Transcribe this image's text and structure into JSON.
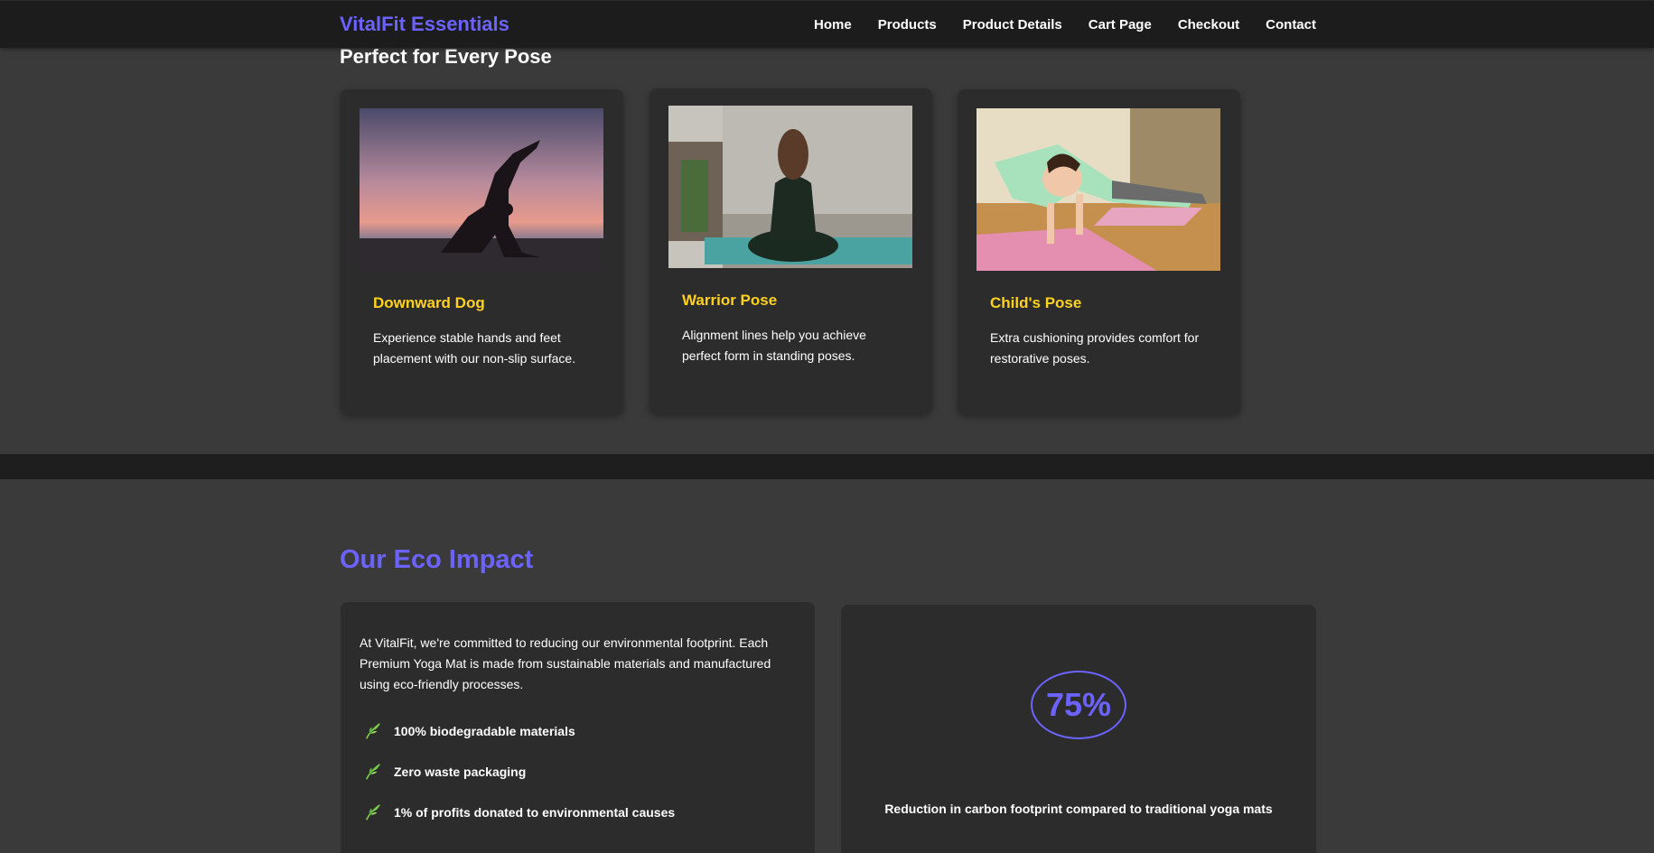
{
  "nav": {
    "brand": "VitalFit Essentials",
    "links": [
      "Home",
      "Products",
      "Product Details",
      "Cart Page",
      "Checkout",
      "Contact"
    ]
  },
  "poses": {
    "title": "Perfect for Every Pose",
    "cards": [
      {
        "title": "Downward Dog",
        "text": "Experience stable hands and feet placement with our non-slip surface.",
        "image": "yoga-silhouette-sunset-photo"
      },
      {
        "title": "Warrior Pose",
        "text": "Alignment lines help you achieve perfect form in standing poses.",
        "image": "seated-yoga-meditation-photo"
      },
      {
        "title": "Child's Pose",
        "text": "Extra cushioning provides comfort for restorative poses.",
        "image": "arm-balance-yoga-class-photo"
      }
    ]
  },
  "eco": {
    "title": "Our Eco Impact",
    "intro": "At VitalFit, we're committed to reducing our environmental footprint. Each Premium Yoga Mat is made from sustainable materials and manufactured using eco-friendly processes.",
    "items": [
      "100% biodegradable materials",
      "Zero waste packaging",
      "1% of profits donated to environmental causes"
    ],
    "item_icon": "leaf-icon",
    "stat_value": "75%",
    "stat_caption": "Reduction in carbon footprint compared to traditional yoga mats"
  },
  "colors": {
    "accent": "#6c63ff",
    "highlight": "#ffd21f",
    "background": "#3a3a3a",
    "card": "#2c2c2c",
    "navbar": "#1c1c1c"
  }
}
